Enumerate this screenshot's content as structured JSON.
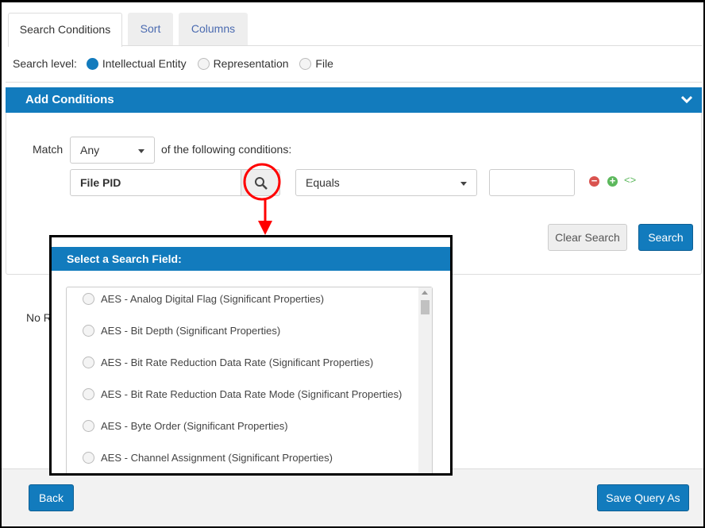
{
  "tabs": [
    {
      "label": "Search Conditions",
      "active": true
    },
    {
      "label": "Sort"
    },
    {
      "label": "Columns"
    }
  ],
  "search_level": {
    "label": "Search level:",
    "options": [
      {
        "label": "Intellectual Entity",
        "selected": true
      },
      {
        "label": "Representation"
      },
      {
        "label": "File"
      }
    ]
  },
  "add_conditions": {
    "title": "Add Conditions",
    "icon": "chevron-down-icon"
  },
  "match": {
    "label": "Match",
    "value": "Any",
    "suffix": "of the following conditions:"
  },
  "condition": {
    "field": "File PID",
    "operator": "Equals",
    "value": ""
  },
  "buttons": {
    "clear": "Clear Search",
    "search": "Search",
    "back": "Back",
    "save": "Save Query As"
  },
  "results_text": "No R",
  "modal": {
    "title": "Select a Search Field:",
    "items": [
      "AES - Analog Digital Flag (Significant Properties)",
      "AES - Bit Depth (Significant Properties)",
      "AES - Bit Rate Reduction Data Rate (Significant Properties)",
      "AES - Bit Rate Reduction Data Rate Mode (Significant Properties)",
      "AES - Byte Order (Significant Properties)",
      "AES - Channel Assignment (Significant Properties)"
    ]
  },
  "colors": {
    "accent": "#127bbd",
    "annotation": "#ff0000",
    "remove": "#d9534f",
    "add": "#5cb85c"
  }
}
